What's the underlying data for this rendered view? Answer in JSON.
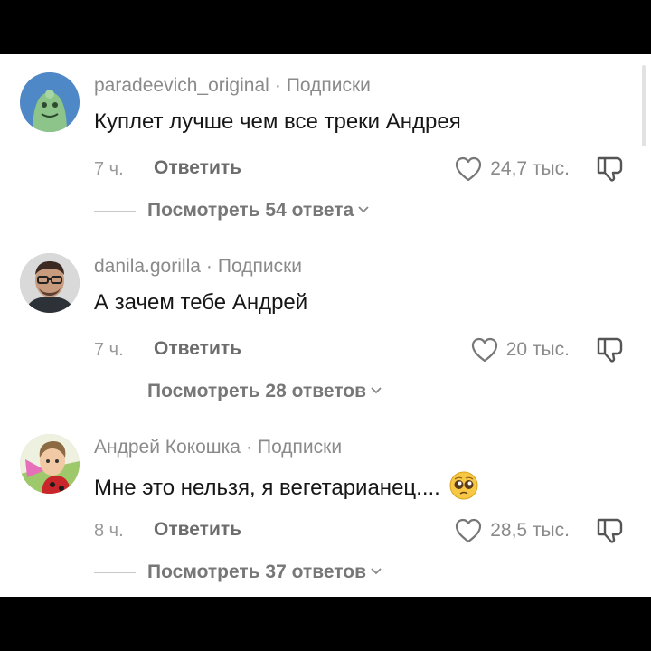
{
  "comments": [
    {
      "username": "paradeevich_original",
      "separator": "·",
      "follow_status": "Подписки",
      "text": "Куплет лучше чем все треки Андрея",
      "time": "7 ч.",
      "reply_label": "Ответить",
      "likes": "24,7 тыс.",
      "view_replies": "Посмотреть 54 ответа",
      "avatar_icon": "cartoon-avatar-icon"
    },
    {
      "username": "danila.gorilla",
      "separator": "·",
      "follow_status": "Подписки",
      "text": "А зачем тебе Андрей",
      "time": "7 ч.",
      "reply_label": "Ответить",
      "likes": "20 тыс.",
      "view_replies": "Посмотреть 28 ответов",
      "avatar_icon": "person-photo-avatar-icon"
    },
    {
      "username": "Андрей Кокошка",
      "separator": "·",
      "follow_status": "Подписки",
      "text": "Мне это нельзя, я вегетарианец....",
      "emoji": "pleading-face-emoji",
      "time": "8 ч.",
      "reply_label": "Ответить",
      "likes": "28,5 тыс.",
      "view_replies": "Посмотреть 37 ответов",
      "avatar_icon": "drawn-character-avatar-icon"
    }
  ],
  "colors": {
    "background": "#ffffff",
    "letterbox": "#000000",
    "text_primary": "#161616",
    "text_secondary": "#8a8a8a"
  }
}
